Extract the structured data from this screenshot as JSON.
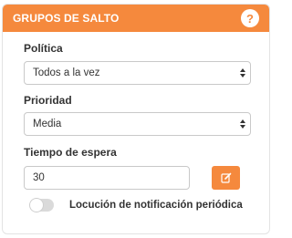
{
  "panel": {
    "title": "GRUPOS DE SALTO",
    "help_icon": "question-icon",
    "accent_color": "#f5893d"
  },
  "fields": {
    "politica": {
      "label": "Política",
      "value": "Todos a la vez"
    },
    "prioridad": {
      "label": "Prioridad",
      "value": "Media"
    },
    "tiempo_espera": {
      "label": "Tiempo de espera",
      "value": "30"
    }
  },
  "edit_button": {
    "icon": "edit-icon"
  },
  "toggle": {
    "label": "Locución de notificación periódica",
    "checked": false
  }
}
